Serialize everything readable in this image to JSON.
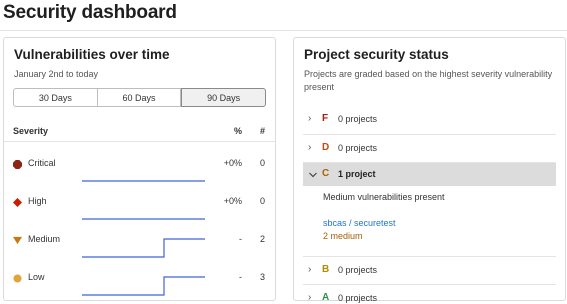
{
  "page": {
    "title": "Security dashboard"
  },
  "vulnerabilities": {
    "title": "Vulnerabilities over time",
    "subtitle": "January 2nd to today",
    "ranges": [
      {
        "label": "30 Days",
        "active": false
      },
      {
        "label": "60 Days",
        "active": false
      },
      {
        "label": "90 Days",
        "active": true
      }
    ],
    "headers": {
      "severity": "Severity",
      "percent": "%",
      "count": "#"
    },
    "rows": [
      {
        "severity": "Critical",
        "percent": "+0%",
        "count": "0",
        "icon": "critical-icon",
        "color": "#8b2615",
        "trend": [
          0,
          0
        ]
      },
      {
        "severity": "High",
        "percent": "+0%",
        "count": "0",
        "icon": "high-icon",
        "color": "#c91c00",
        "trend": [
          0,
          0
        ]
      },
      {
        "severity": "Medium",
        "percent": "-",
        "count": "2",
        "icon": "medium-icon",
        "color": "#c17d10",
        "trend": [
          0,
          0,
          2,
          2
        ]
      },
      {
        "severity": "Low",
        "percent": "-",
        "count": "3",
        "icon": "low-icon",
        "color": "#e0a43a",
        "trend": [
          0,
          0,
          3,
          3
        ]
      }
    ],
    "spark_color": "#3f64d6"
  },
  "projects": {
    "title": "Project security status",
    "subtitle_line1": "Projects are graded based on the highest severity vulnerability",
    "subtitle_line2": "present",
    "grades": [
      {
        "letter": "F",
        "count": "0 projects",
        "color": "#a3210e",
        "expanded": false
      },
      {
        "letter": "D",
        "count": "0 projects",
        "color": "#c24a0c",
        "expanded": false
      },
      {
        "letter": "C",
        "count": "1 project",
        "color": "#ab6100",
        "expanded": true
      },
      {
        "letter": "B",
        "count": "0 projects",
        "color": "#b08b0a",
        "expanded": false
      },
      {
        "letter": "A",
        "count": "0 projects",
        "color": "#2f8f49",
        "expanded": false
      }
    ],
    "expanded_detail": {
      "message": "Medium vulnerabilities present",
      "project": "sbcas / securetest",
      "severity_count": "2 medium"
    }
  }
}
